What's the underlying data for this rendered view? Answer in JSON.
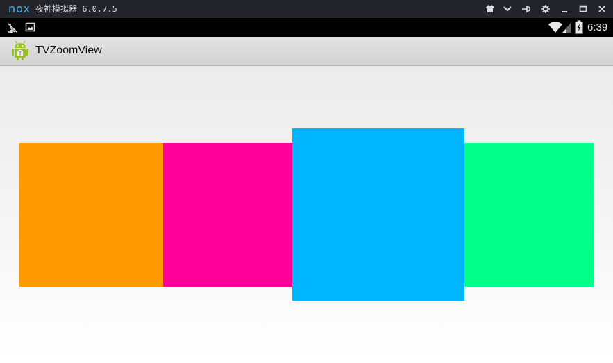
{
  "emulator": {
    "logo": "nox",
    "title": "夜神模拟器 6.0.7.5",
    "controls": [
      "shirt-icon",
      "chevron-down-icon",
      "pin-icon",
      "gear-icon",
      "minimize-icon",
      "maximize-icon",
      "close-icon"
    ]
  },
  "status_bar": {
    "left_icons": [
      "debug-icon",
      "screenshot-icon"
    ],
    "time": "6:39"
  },
  "action_bar": {
    "app_title": "TVZoomView"
  },
  "tiles": [
    {
      "color": "#ff9900",
      "focused": false
    },
    {
      "color": "#ff0099",
      "focused": false
    },
    {
      "color": "#00b7ff",
      "focused": true
    },
    {
      "color": "#00ff88",
      "focused": false
    }
  ],
  "colors": {
    "emulator_bg": "#23252a",
    "nox_accent": "#3fb0e6",
    "status_bar_bg": "#000000",
    "action_bar_bg": "#d9d9d9"
  }
}
